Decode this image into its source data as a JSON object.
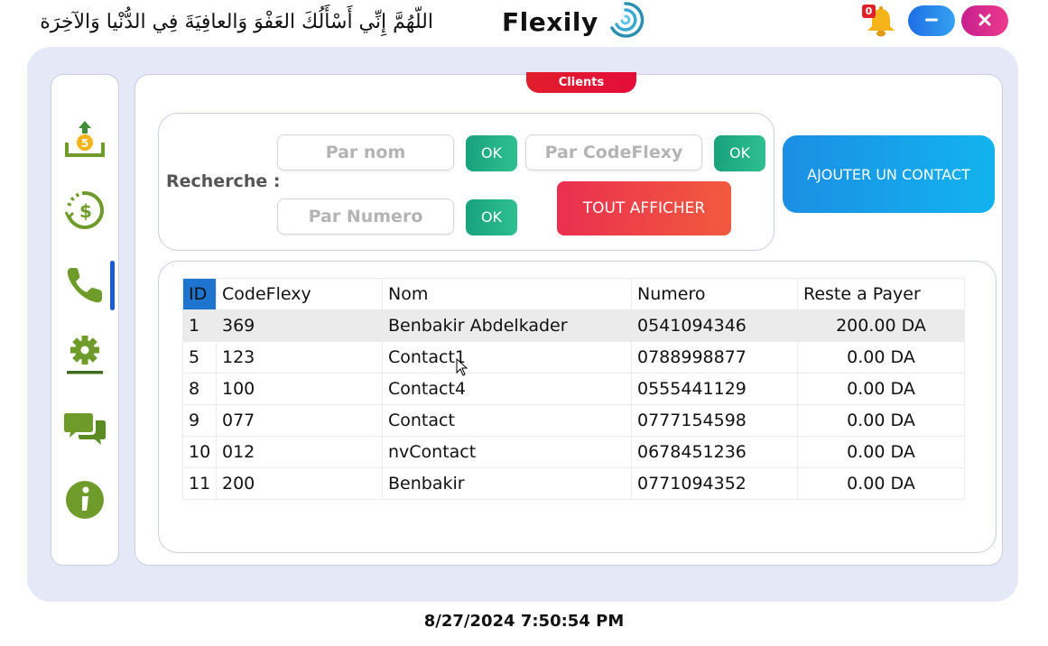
{
  "header": {
    "prayer_text": "اللّهُمَّ إِنِّي أَسْأَلُكَ العَفْوَ وَالعافِيَةَ فِي الدُّنْيا وَالآخِرَة",
    "app_name": "Flexily",
    "notification_count": "0",
    "icons": {
      "bell": "bell-icon",
      "minimize": "minimize-icon",
      "close": "close-icon",
      "logo": "swirl-logo-icon"
    }
  },
  "sidebar": {
    "items": [
      {
        "name": "money-upload-icon",
        "active": false
      },
      {
        "name": "dollar-refresh-icon",
        "active": false
      },
      {
        "name": "phone-icon",
        "active": true
      },
      {
        "name": "gear-icon",
        "active": false
      },
      {
        "name": "chat-icon",
        "active": false
      },
      {
        "name": "info-icon",
        "active": false
      }
    ]
  },
  "page": {
    "tab_title": "Clients"
  },
  "search": {
    "label": "Recherche :",
    "by_name_placeholder": "Par nom",
    "by_code_placeholder": "Par CodeFlexy",
    "by_number_placeholder": "Par Numero",
    "ok_label": "OK",
    "show_all_label": "TOUT AFFICHER"
  },
  "actions": {
    "add_contact_label": "AJOUTER UN CONTACT"
  },
  "table": {
    "columns": [
      "ID",
      "CodeFlexy",
      "Nom",
      "Numero",
      "Reste a Payer"
    ],
    "rows": [
      [
        "1",
        "369",
        "Benbakir Abdelkader",
        "0541094346",
        "200.00 DA"
      ],
      [
        "5",
        "123",
        "Contact1",
        "0788998877",
        "0.00 DA"
      ],
      [
        "8",
        "100",
        "Contact4",
        "0555441129",
        "0.00 DA"
      ],
      [
        "9",
        "077",
        "Contact",
        "0777154598",
        "0.00 DA"
      ],
      [
        "10",
        "012",
        "nvContact",
        "0678451236",
        "0.00 DA"
      ],
      [
        "11",
        "200",
        "Benbakir",
        "0771094352",
        "0.00 DA"
      ]
    ],
    "selected_row": 0
  },
  "footer": {
    "datetime": "8/27/2024 7:50:54 PM"
  },
  "colors": {
    "frame_bg": "#e5e8f6",
    "ok_green": "#18a27d",
    "show_all_red": "#ea2f4f",
    "add_blue": "#1b8fe4",
    "tab_red": "#e11e2b",
    "sidebar_green": "#6f9b2b",
    "active_indicator": "#1b5cd6"
  }
}
